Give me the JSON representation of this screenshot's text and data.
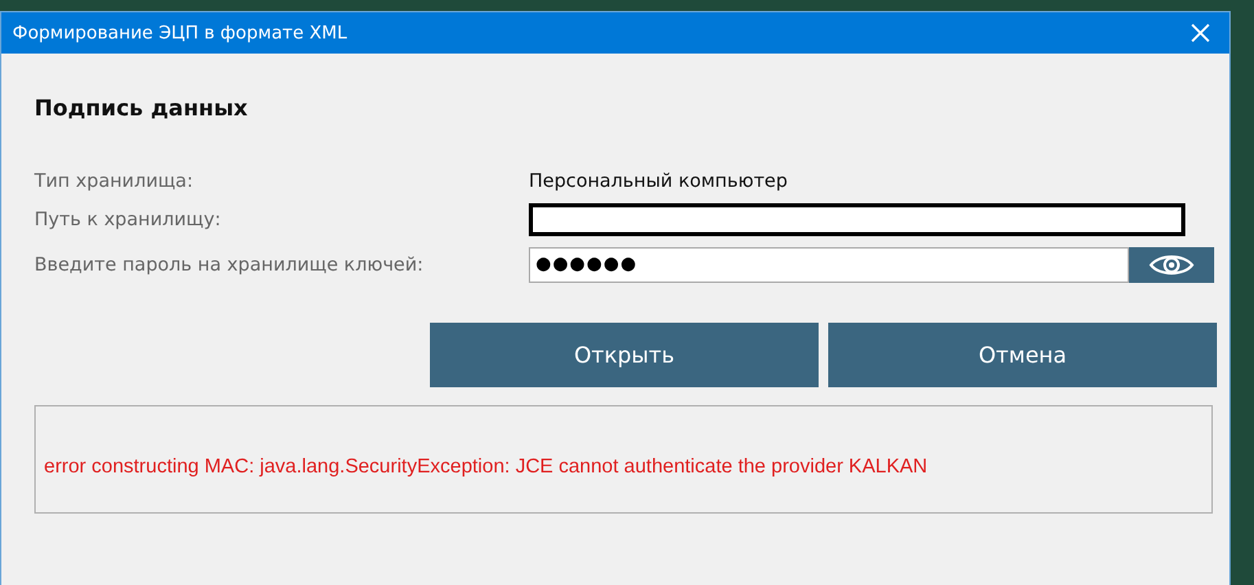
{
  "window": {
    "title": "Формирование ЭЦП в формате XML"
  },
  "heading": "Подпись данных",
  "fields": [
    {
      "kind": "text",
      "label": "Тип хранилища:",
      "value": "Персональный компьютер"
    },
    {
      "kind": "redacted",
      "label": "Путь к хранилищу:"
    },
    {
      "kind": "password",
      "label": "Введите пароль на хранилище ключей:",
      "value": "●●●●●●"
    }
  ],
  "buttons": [
    "Открыть",
    "Отмена"
  ],
  "error_message": "error constructing MAC: java.lang.SecurityException: JCE cannot authenticate the provider KALKAN"
}
